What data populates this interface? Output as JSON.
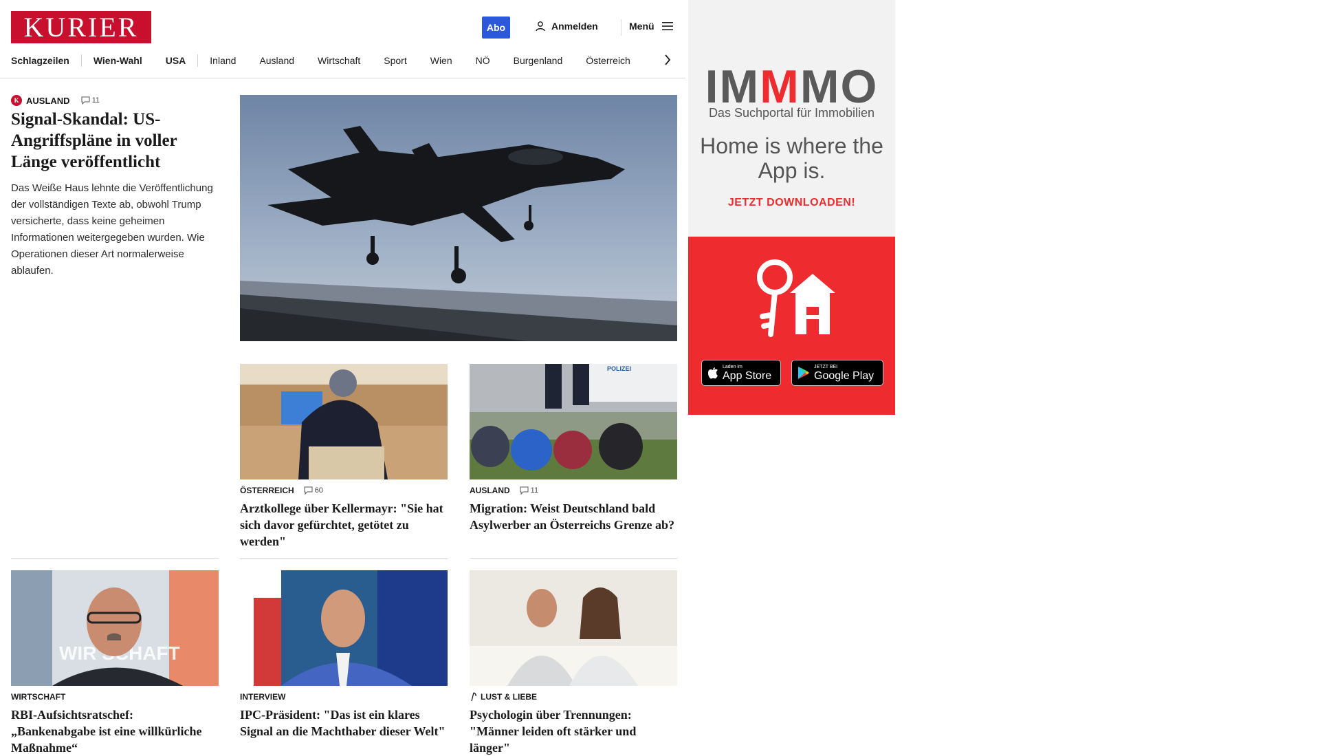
{
  "header": {
    "logo": "KURIER",
    "abo_label": "Abo",
    "login_label": "Anmelden",
    "menu_label": "Menü"
  },
  "nav": {
    "items": [
      "Schlagzeilen",
      "Wien-Wahl",
      "USA",
      "Inland",
      "Ausland",
      "Wirtschaft",
      "Sport",
      "Wien",
      "NÖ",
      "Burgenland",
      "Österreich"
    ]
  },
  "lead": {
    "category": "Ausland",
    "badge": "K",
    "comments": "11",
    "title": "Signal-Skandal: US-Angriffspläne in voller Länge veröffentlicht",
    "teaser": "Das Weiße Haus lehnte die Veröffentlichung der vollständigen Texte ab, obwohl Trump versicherte, dass keine geheimen Informationen weitergegeben wurden. Wie Operationen dieser Art normalerweise ablaufen."
  },
  "cards": [
    {
      "category": "Österreich",
      "comments": "60",
      "title": "Arztkollege über Kellermayr: \"Sie hat sich davor gefürchtet, getötet zu werden\""
    },
    {
      "category": "Ausland",
      "comments": "11",
      "title": "Migration: Weist Deutschland bald Asylwerber an Österreichs Grenze ab?",
      "image_text": "POLIZEI"
    },
    {
      "category": "Wirtschaft",
      "title": "RBI-Aufsichtsratschef: „Bankenabgabe ist eine willkürliche Maßnahme“",
      "image_text": "WIR SCHAFT"
    },
    {
      "category": "Interview",
      "title": "IPC-Präsident: \"Das ist ein klares Signal an die Machthaber dieser Welt\""
    },
    {
      "category": "Lust & Liebe",
      "title": "Psychologin über Trennungen: \"Männer leiden oft stärker und länger\""
    }
  ],
  "ad": {
    "brand_pre": "IM",
    "brand_mid": "M",
    "brand_post": "MO",
    "subtitle": "Das Suchportal für Immobilien",
    "slogan": "Home is where the App is.",
    "cta": "JETZT DOWNLOADEN!",
    "appstore_small": "Laden im",
    "appstore_big": "App Store",
    "googleplay_small": "JETZT BEI",
    "googleplay_big": "Google Play",
    "colors": {
      "red": "#ee2b2e",
      "grey": "#5a5a5a"
    }
  },
  "colors": {
    "brand": "#c8102e",
    "abo": "#2b59d9"
  }
}
